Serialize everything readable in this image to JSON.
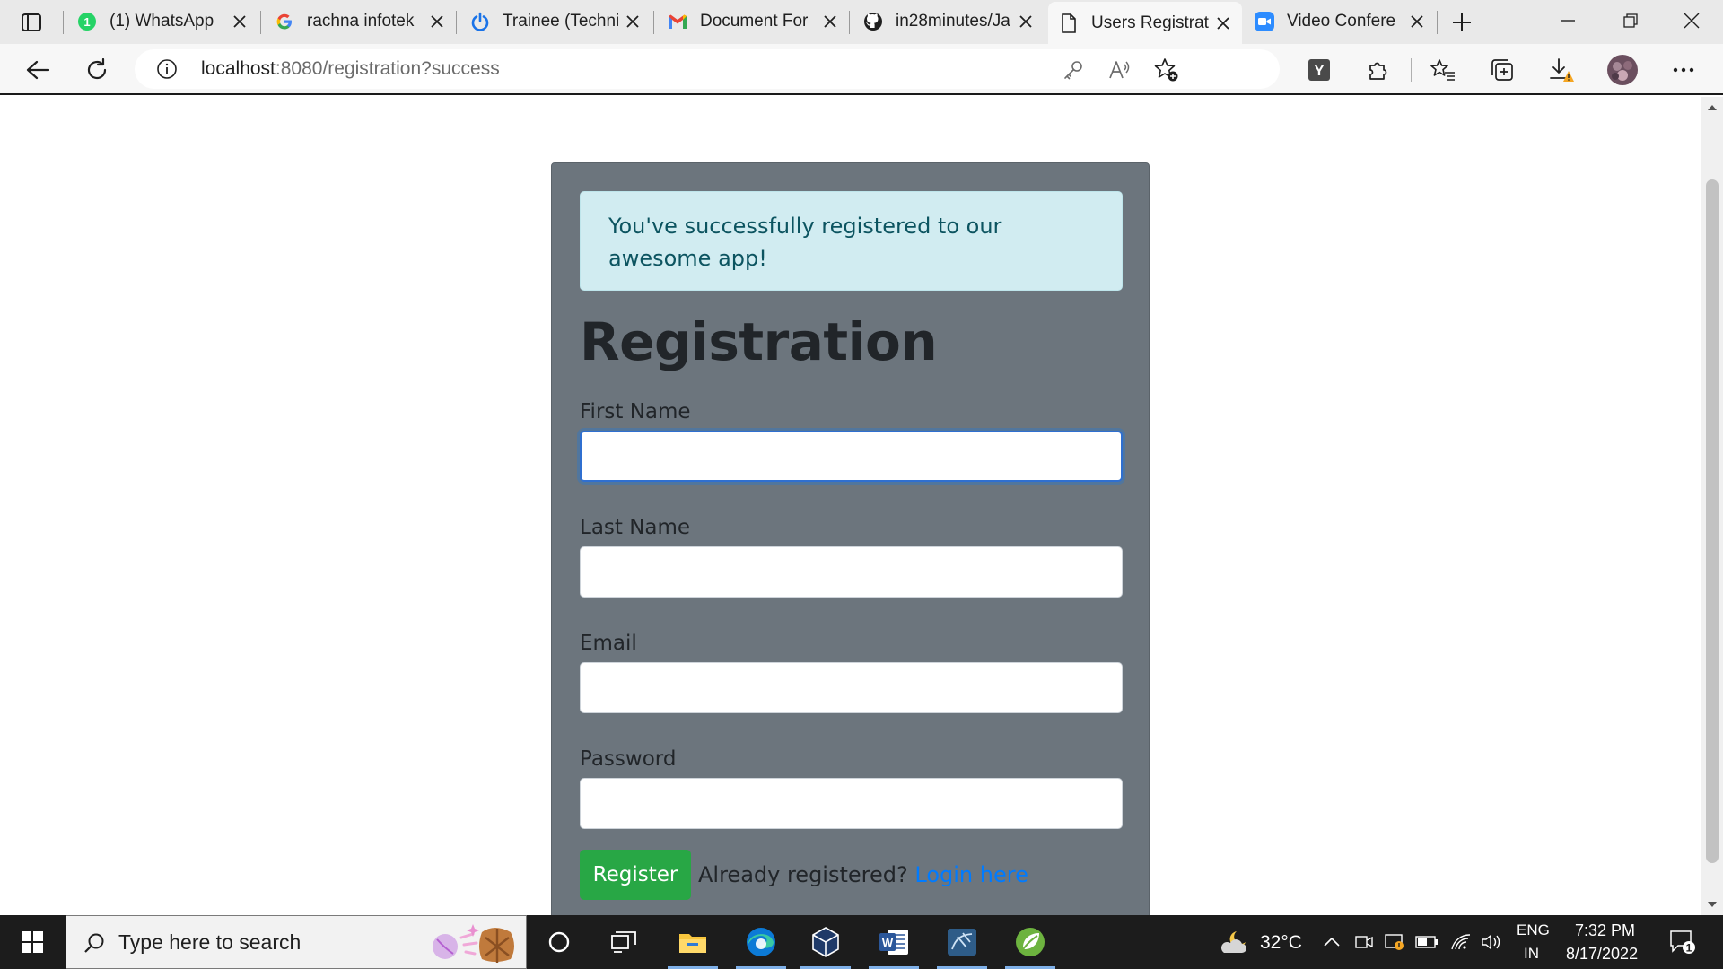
{
  "browser": {
    "tabs": [
      {
        "title": "(1) WhatsApp",
        "icon": "whatsapp-icon",
        "badge": "1"
      },
      {
        "title": "rachna infotek",
        "icon": "google-icon"
      },
      {
        "title": "Trainee (Techni",
        "icon": "power-icon"
      },
      {
        "title": "Document For",
        "icon": "gmail-icon"
      },
      {
        "title": "in28minutes/Ja",
        "icon": "github-icon"
      },
      {
        "title": "Users Registrat",
        "icon": "document-icon"
      },
      {
        "title": "Video Confere",
        "icon": "zoom-icon"
      }
    ],
    "active_tab_index": 5,
    "url_host": "localhost",
    "url_path": ":8080/registration?success",
    "extension_label": "Y",
    "colors": {
      "accent": "#007bff",
      "tab_strip": "#e9e9e9"
    }
  },
  "page": {
    "alert_text": "You've successfully registered to our awesome app!",
    "title": "Registration",
    "fields": [
      {
        "label": "First Name",
        "value": ""
      },
      {
        "label": "Last Name",
        "value": ""
      },
      {
        "label": "Email",
        "value": ""
      },
      {
        "label": "Password",
        "value": ""
      }
    ],
    "register_label": "Register",
    "already_text": "Already registered?",
    "login_link": "Login here",
    "colors": {
      "card_bg": "#6c757d",
      "alert_bg": "#d1ecf1",
      "button_bg": "#28a745"
    }
  },
  "taskbar": {
    "search_placeholder": "Type here to search",
    "weather_temp": "32°C",
    "language": "ENG",
    "region": "IN",
    "time": "7:32 PM",
    "date": "8/17/2022",
    "notification_count": "1"
  }
}
